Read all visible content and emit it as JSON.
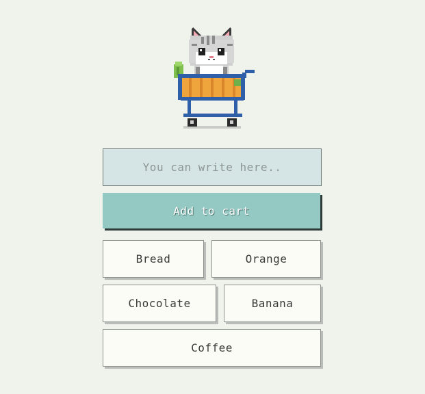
{
  "mascot": {
    "icon": "cat-in-shopping-cart-icon"
  },
  "input": {
    "placeholder": "You can write here..",
    "value": ""
  },
  "add_button": {
    "label": "Add to cart"
  },
  "items": {
    "bread": "Bread",
    "orange": "Orange",
    "chocolate": "Chocolate",
    "banana": "Banana",
    "coffee": "Coffee"
  },
  "colors": {
    "background": "#eff3ec",
    "input_bg": "#d5e5e5",
    "accent": "#94c8c2",
    "item_bg": "#fcfcf6",
    "cart_blue": "#2f5fa8",
    "basket_orange": "#f0a53c"
  }
}
